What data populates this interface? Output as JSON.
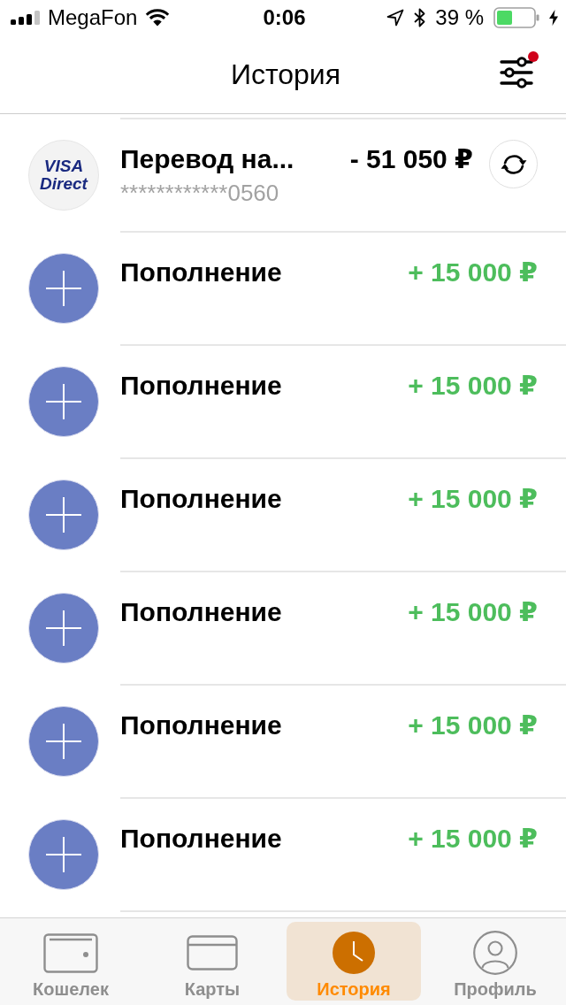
{
  "status_bar": {
    "carrier": "MegaFon",
    "time": "0:06",
    "battery": "39 %"
  },
  "nav_bar": {
    "title": "История",
    "filter_has_badge": true
  },
  "transactions": [
    {
      "kind": "transfer",
      "logo_text": "VISA Direct",
      "title": "Перевод на...",
      "subtitle": "************0560",
      "amount": "- 51 050 ₽"
    },
    {
      "kind": "top_up",
      "title": "Пополнение",
      "amount": "+ 15 000 ₽"
    },
    {
      "kind": "top_up",
      "title": "Пополнение",
      "amount": "+ 15 000 ₽"
    },
    {
      "kind": "top_up",
      "title": "Пополнение",
      "amount": "+ 15 000 ₽"
    },
    {
      "kind": "top_up",
      "title": "Пополнение",
      "amount": "+ 15 000 ₽"
    },
    {
      "kind": "top_up",
      "title": "Пополнение",
      "amount": "+ 15 000 ₽"
    },
    {
      "kind": "top_up",
      "title": "Пополнение",
      "amount": "+ 15 000 ₽"
    }
  ],
  "tab_bar": [
    {
      "label": "Кошелек",
      "selected": false
    },
    {
      "label": "Карты",
      "selected": false
    },
    {
      "label": "История",
      "selected": true
    },
    {
      "label": "Профиль",
      "selected": false
    }
  ]
}
